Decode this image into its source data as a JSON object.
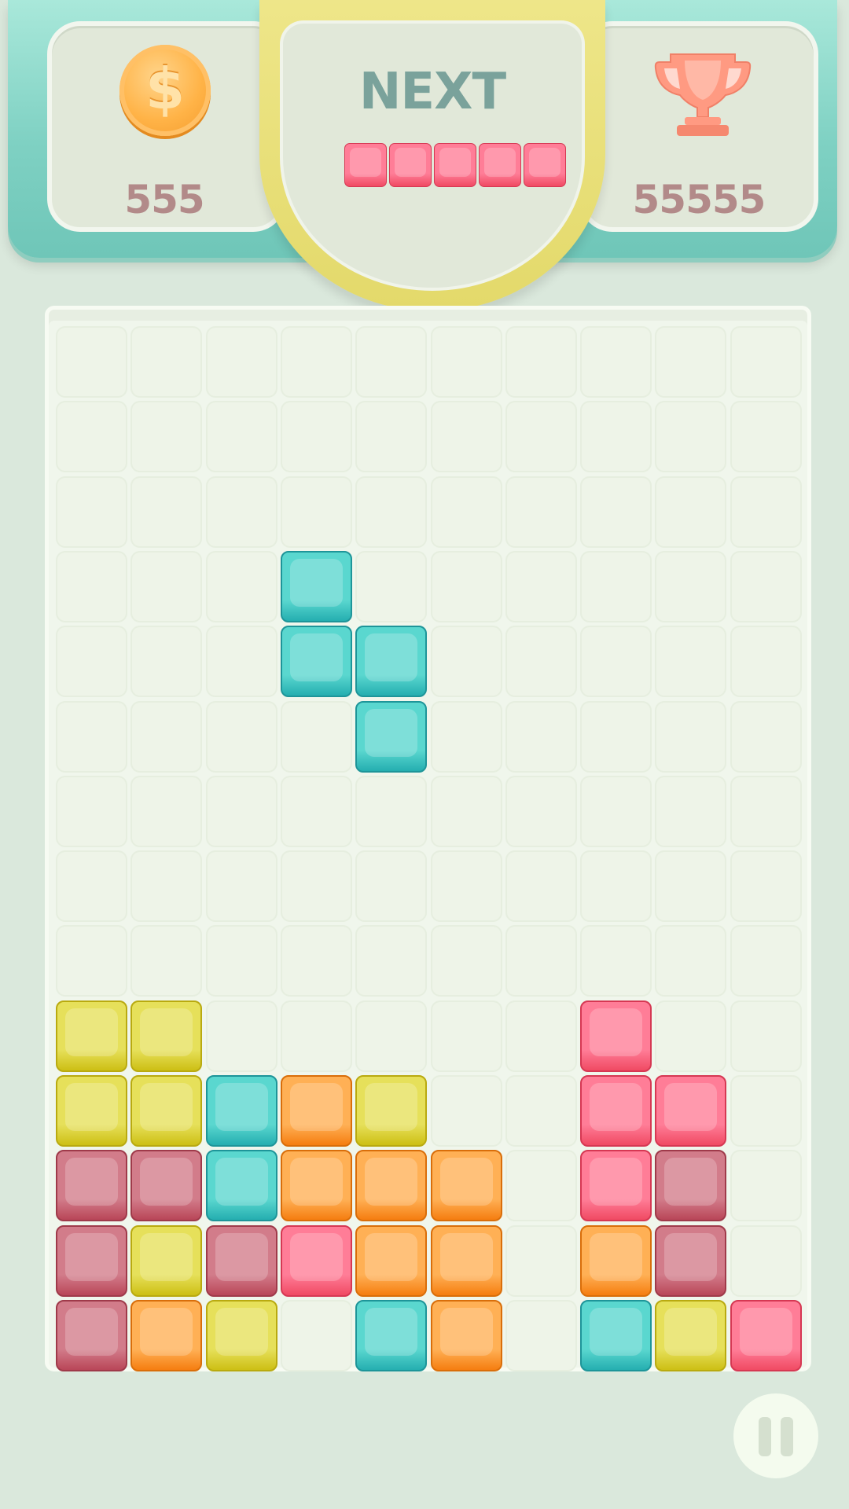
{
  "hud": {
    "coins": "555",
    "best_score": "55555",
    "next_label": "NEXT",
    "coin_symbol": "$"
  },
  "icons": {
    "coin": "coin-icon",
    "trophy": "trophy-icon",
    "pause": "pause-icon"
  },
  "colors": {
    "teal": "#4fd0c8",
    "yellow": "#ded84a",
    "orange": "#ffa140",
    "pink": "#ff6f8c",
    "maroon": "#c96b7b"
  },
  "next_piece": {
    "shape": "I5-horizontal",
    "color": "pink",
    "cells": 5
  },
  "board": {
    "cols": 10,
    "rows": 14,
    "active_piece": {
      "color": "teal",
      "cells": [
        [
          3,
          3
        ],
        [
          3,
          4
        ],
        [
          4,
          4
        ],
        [
          4,
          5
        ]
      ]
    },
    "stack": [
      {
        "col": 0,
        "row": 9,
        "color": "yellow"
      },
      {
        "col": 1,
        "row": 9,
        "color": "yellow"
      },
      {
        "col": 7,
        "row": 9,
        "color": "pink"
      },
      {
        "col": 0,
        "row": 10,
        "color": "yellow"
      },
      {
        "col": 1,
        "row": 10,
        "color": "yellow"
      },
      {
        "col": 2,
        "row": 10,
        "color": "teal"
      },
      {
        "col": 3,
        "row": 10,
        "color": "orange"
      },
      {
        "col": 4,
        "row": 10,
        "color": "yellow"
      },
      {
        "col": 7,
        "row": 10,
        "color": "pink"
      },
      {
        "col": 8,
        "row": 10,
        "color": "pink"
      },
      {
        "col": 0,
        "row": 11,
        "color": "maroon"
      },
      {
        "col": 1,
        "row": 11,
        "color": "maroon"
      },
      {
        "col": 2,
        "row": 11,
        "color": "teal"
      },
      {
        "col": 3,
        "row": 11,
        "color": "orange"
      },
      {
        "col": 4,
        "row": 11,
        "color": "orange"
      },
      {
        "col": 5,
        "row": 11,
        "color": "orange"
      },
      {
        "col": 7,
        "row": 11,
        "color": "pink"
      },
      {
        "col": 8,
        "row": 11,
        "color": "maroon"
      },
      {
        "col": 0,
        "row": 12,
        "color": "maroon"
      },
      {
        "col": 1,
        "row": 12,
        "color": "yellow"
      },
      {
        "col": 2,
        "row": 12,
        "color": "maroon"
      },
      {
        "col": 3,
        "row": 12,
        "color": "pink"
      },
      {
        "col": 4,
        "row": 12,
        "color": "orange"
      },
      {
        "col": 5,
        "row": 12,
        "color": "orange"
      },
      {
        "col": 7,
        "row": 12,
        "color": "orange"
      },
      {
        "col": 8,
        "row": 12,
        "color": "maroon"
      },
      {
        "col": 0,
        "row": 13,
        "color": "maroon"
      },
      {
        "col": 1,
        "row": 13,
        "color": "orange"
      },
      {
        "col": 2,
        "row": 13,
        "color": "yellow"
      },
      {
        "col": 4,
        "row": 13,
        "color": "teal"
      },
      {
        "col": 5,
        "row": 13,
        "color": "orange"
      },
      {
        "col": 7,
        "row": 13,
        "color": "teal"
      },
      {
        "col": 8,
        "row": 13,
        "color": "yellow"
      },
      {
        "col": 9,
        "row": 13,
        "color": "pink"
      }
    ]
  }
}
